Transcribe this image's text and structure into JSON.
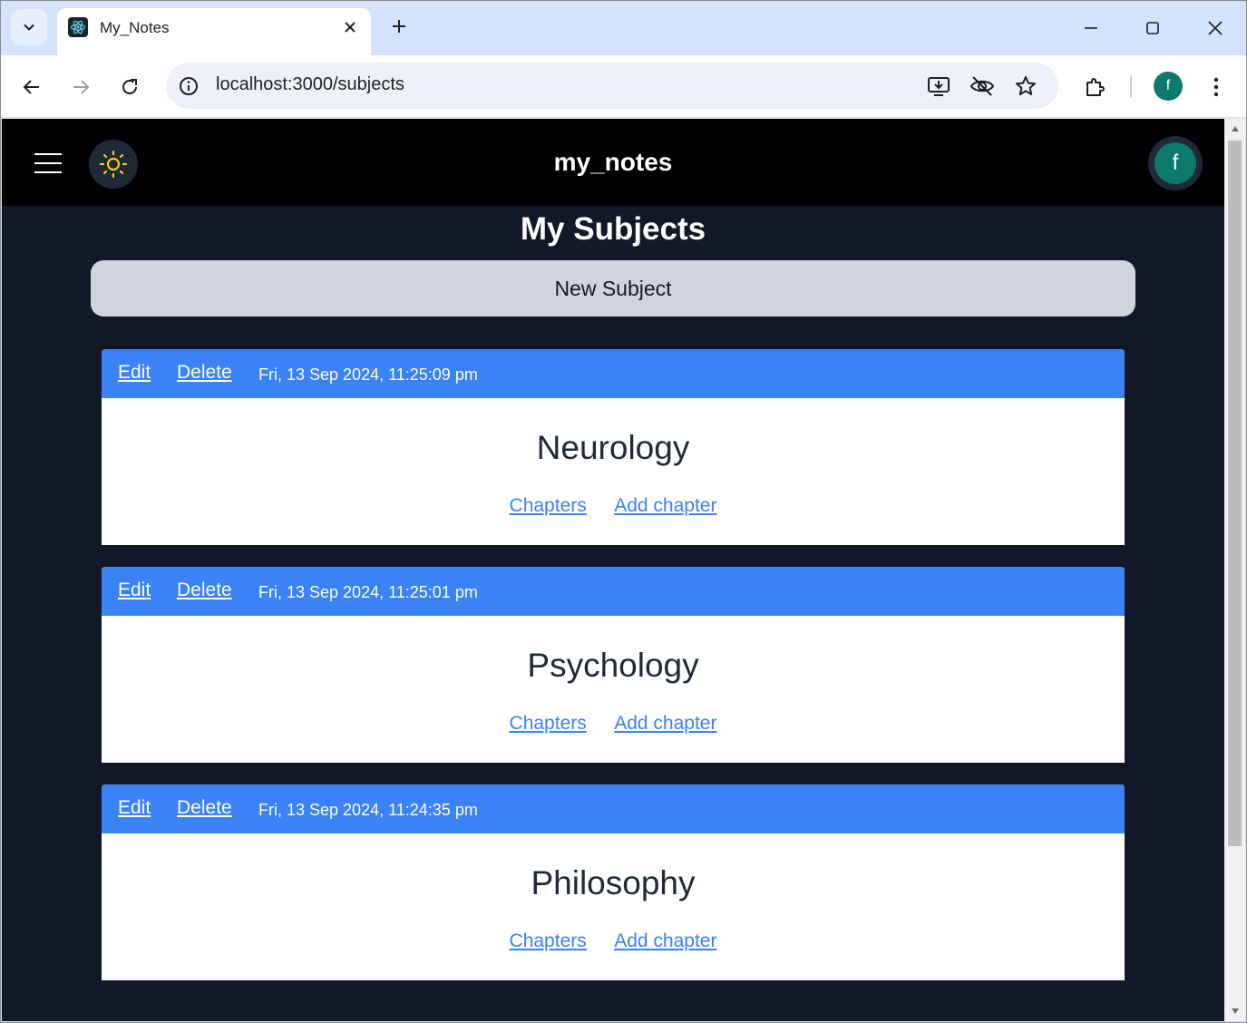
{
  "browser": {
    "tab_title": "My_Notes",
    "url": "localhost:3000/subjects",
    "profile_initial": "f"
  },
  "header": {
    "app_title": "my_notes",
    "avatar_initial": "f"
  },
  "page": {
    "heading": "My Subjects",
    "new_subject_label": "New Subject"
  },
  "subjects": [
    {
      "edit_label": "Edit",
      "delete_label": "Delete",
      "date": "Fri, 13 Sep 2024, 11:25:09 pm",
      "name": "Neurology",
      "chapters_label": "Chapters",
      "add_chapter_label": "Add chapter"
    },
    {
      "edit_label": "Edit",
      "delete_label": "Delete",
      "date": "Fri, 13 Sep 2024, 11:25:01 pm",
      "name": "Psychology",
      "chapters_label": "Chapters",
      "add_chapter_label": "Add chapter"
    },
    {
      "edit_label": "Edit",
      "delete_label": "Delete",
      "date": "Fri, 13 Sep 2024, 11:24:35 pm",
      "name": "Philosophy",
      "chapters_label": "Chapters",
      "add_chapter_label": "Add chapter"
    }
  ],
  "icons": {
    "tab_search": "chevron-down-icon",
    "favicon": "react-icon",
    "tab_close": "close-icon",
    "new_tab": "plus-icon",
    "minimize": "minimize-icon",
    "maximize": "maximize-icon",
    "close_window": "close-icon",
    "back": "arrow-left-icon",
    "forward": "arrow-right-icon",
    "reload": "reload-icon",
    "site_info": "info-icon",
    "install": "install-app-icon",
    "eye_off": "eye-off-icon",
    "bookmark": "star-icon",
    "extensions": "puzzle-icon",
    "menu": "kebab-menu-icon",
    "hamburger": "hamburger-icon",
    "theme": "sun-icon"
  },
  "colors": {
    "appbar": "#000000",
    "background": "#111827",
    "card_header": "#3b82f6",
    "link": "#3b82f6",
    "new_subject_button": "#d1d5db",
    "avatar": "#0b7a6c",
    "sun": "#facc15"
  }
}
